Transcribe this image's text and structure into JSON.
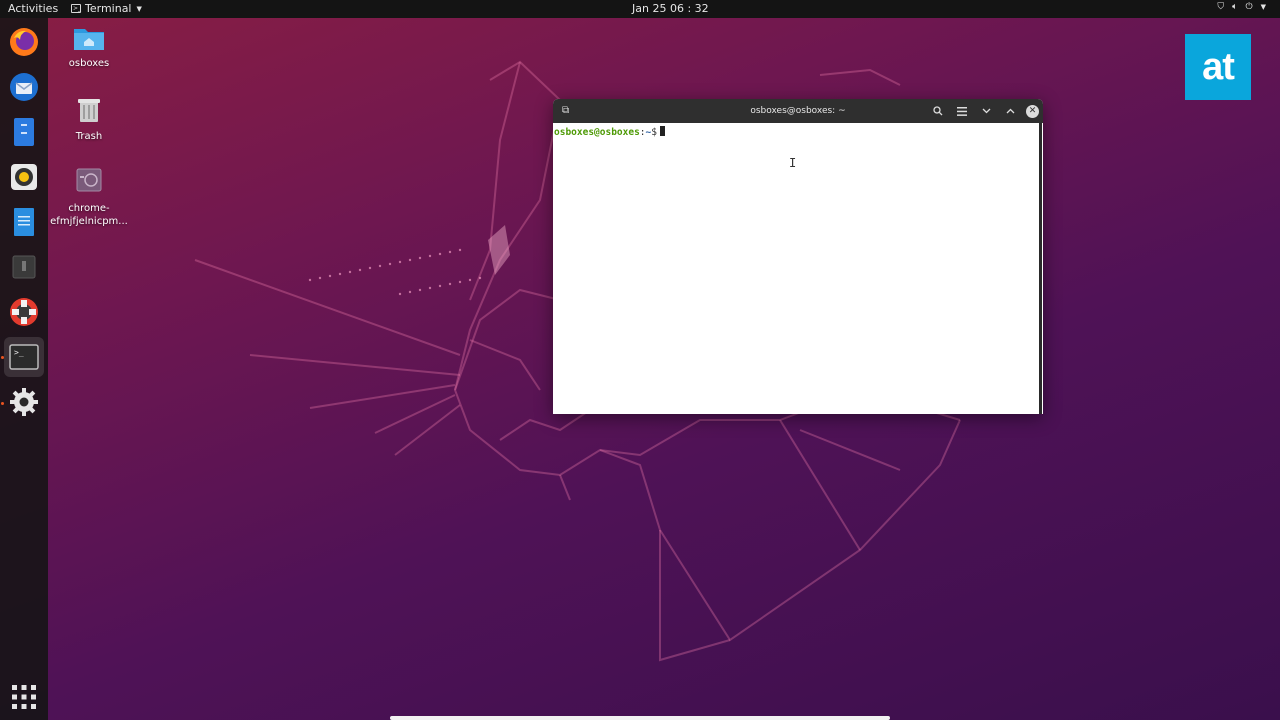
{
  "topbar": {
    "activities": "Activities",
    "app_name": "Terminal",
    "clock": "Jan 25  06 : 32"
  },
  "dock": {
    "items": [
      {
        "name": "firefox-icon"
      },
      {
        "name": "thunderbird-icon"
      },
      {
        "name": "files-icon"
      },
      {
        "name": "rhythmbox-icon"
      },
      {
        "name": "writer-icon"
      },
      {
        "name": "software-icon"
      },
      {
        "name": "help-icon"
      },
      {
        "name": "terminal-icon",
        "active": true
      },
      {
        "name": "settings-icon"
      }
    ],
    "apps_grid": "show-applications-icon"
  },
  "desktop": {
    "icons": [
      {
        "label": "osboxes",
        "icon": "home-folder-icon"
      },
      {
        "label": "Trash",
        "icon": "trash-icon"
      },
      {
        "label": "chrome-efmjfjelnicpm...",
        "icon": "chrome-app-icon"
      }
    ]
  },
  "brand": {
    "text": "at",
    "color": "#0aa6dc"
  },
  "terminal": {
    "title": "osboxes@osboxes: ~",
    "prompt_user": "osboxes@osboxes",
    "prompt_sep": ":",
    "prompt_path": "~",
    "prompt_symbol": "$"
  },
  "colors": {
    "topbar": "#141414",
    "accent": "#e95420",
    "term_header": "#2f2f2f",
    "prompt_user": "#4e9a06",
    "prompt_path": "#3465a4"
  }
}
